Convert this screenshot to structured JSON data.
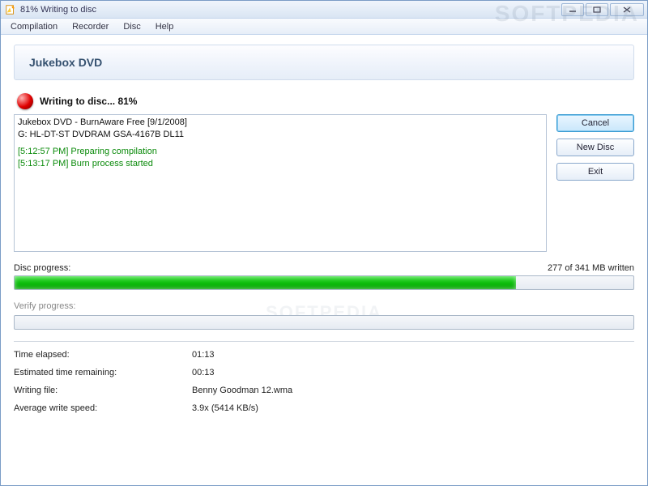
{
  "window": {
    "title": "81% Writing to disc"
  },
  "menu": {
    "compilation": "Compilation",
    "recorder": "Recorder",
    "disc": "Disc",
    "help": "Help"
  },
  "header": {
    "page_title": "Jukebox DVD"
  },
  "status": {
    "text": "Writing to disc... 81%"
  },
  "log": {
    "line1": "Jukebox DVD - BurnAware Free [9/1/2008]",
    "line2": "G: HL-DT-ST DVDRAM GSA-4167B DL11",
    "line3": "[5:12:57 PM] Preparing compilation",
    "line4": "[5:13:17 PM] Burn process started"
  },
  "buttons": {
    "cancel": "Cancel",
    "new_disc": "New Disc",
    "exit": "Exit"
  },
  "disc_progress": {
    "label": "Disc progress:",
    "written_text": "277 of 341 MB written",
    "percent": 81
  },
  "verify_progress": {
    "label": "Verify progress:",
    "percent": 0
  },
  "stats": {
    "time_elapsed_label": "Time elapsed:",
    "time_elapsed_value": "01:13",
    "est_remaining_label": "Estimated time remaining:",
    "est_remaining_value": "00:13",
    "writing_file_label": "Writing file:",
    "writing_file_value": "Benny Goodman 12.wma",
    "avg_speed_label": "Average write speed:",
    "avg_speed_value": "3.9x (5414 KB/s)"
  },
  "watermark": "SOFTPEDIA"
}
